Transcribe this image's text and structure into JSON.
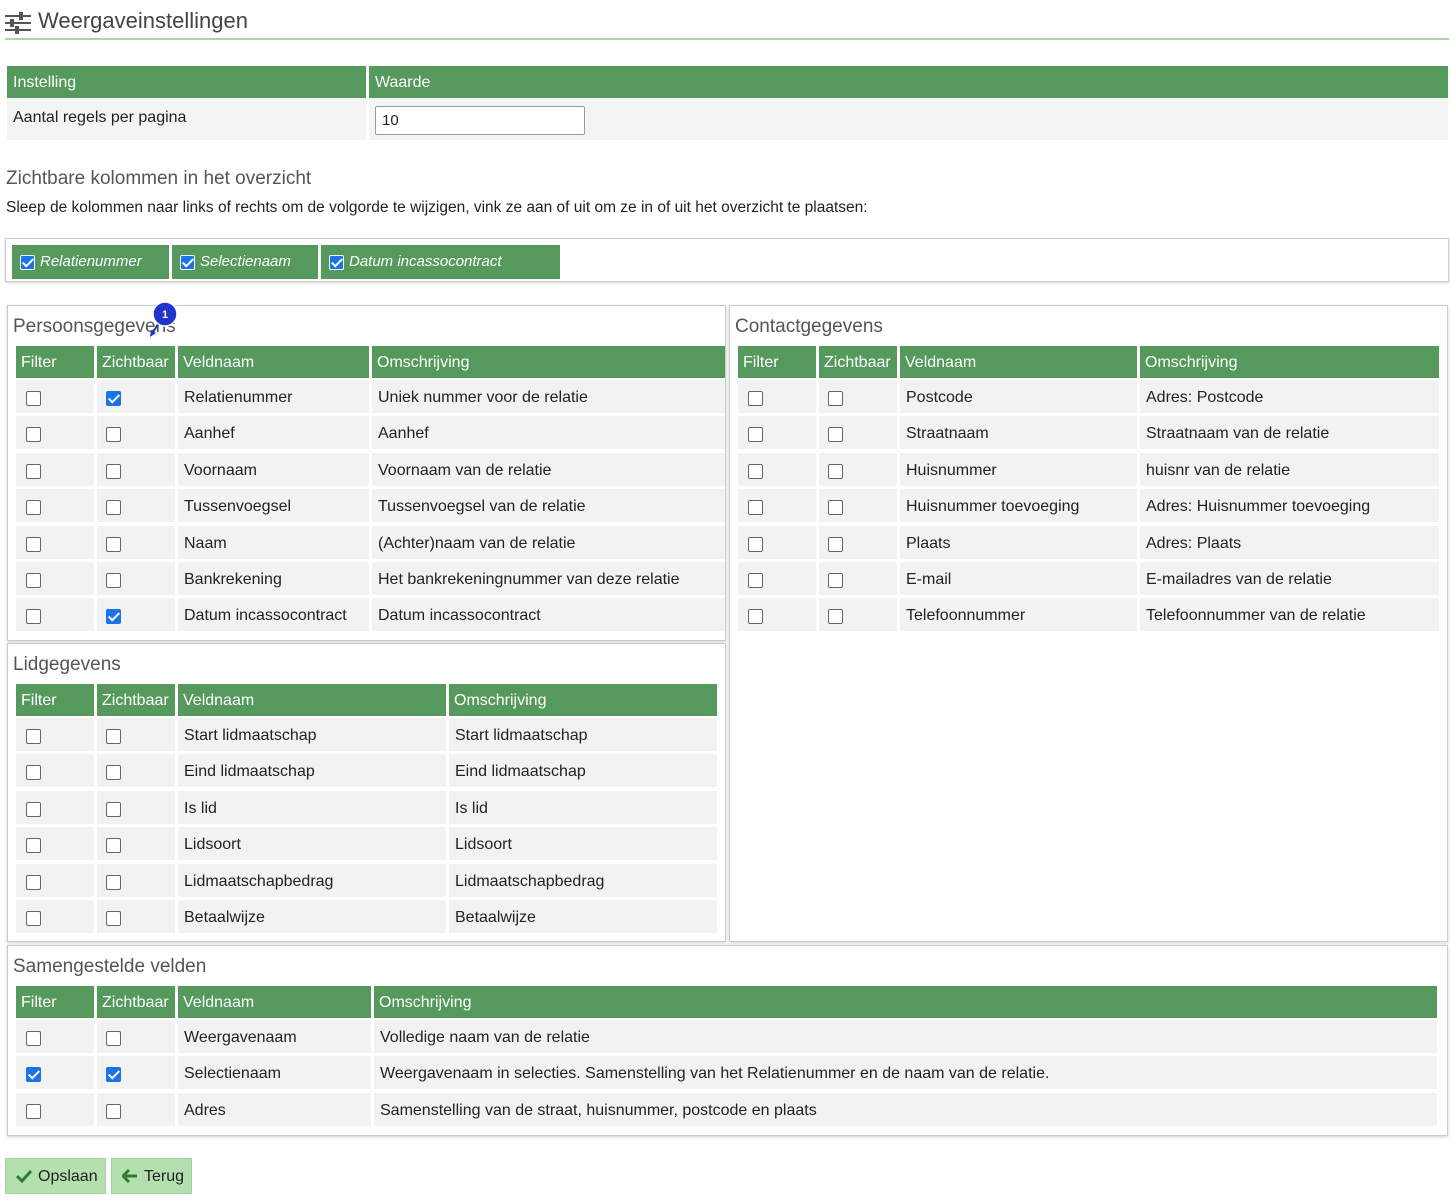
{
  "page": {
    "title": "Weergaveinstellingen"
  },
  "settings": {
    "col_setting": "Instelling",
    "col_value": "Waarde",
    "rows_label": "Aantal regels per pagina",
    "rows_value": "10"
  },
  "columns_section": {
    "title": "Zichtbare kolommen in het overzicht",
    "description": "Sleep de kolommen naar links of rechts om de volgorde te wijzigen, vink ze aan of uit om ze in of uit het overzicht te plaatsen:",
    "chips": [
      "Relatienummer",
      "Selectienaam",
      "Datum incassocontract"
    ]
  },
  "headers": {
    "filter": "Filter",
    "visible": "Zichtbaar",
    "field": "Veldnaam",
    "description": "Omschrijving"
  },
  "persoonsgegevens": {
    "title": "Persoonsgegevens",
    "rows": [
      {
        "filter": false,
        "visible": true,
        "field": "Relatienummer",
        "description": "Uniek nummer voor de relatie"
      },
      {
        "filter": false,
        "visible": false,
        "field": "Aanhef",
        "description": "Aanhef"
      },
      {
        "filter": false,
        "visible": false,
        "field": "Voornaam",
        "description": "Voornaam van de relatie"
      },
      {
        "filter": false,
        "visible": false,
        "field": "Tussenvoegsel",
        "description": "Tussenvoegsel van de relatie"
      },
      {
        "filter": false,
        "visible": false,
        "field": "Naam",
        "description": "(Achter)naam van de relatie"
      },
      {
        "filter": false,
        "visible": false,
        "field": "Bankrekening",
        "description": "Het bankrekeningnummer van deze relatie"
      },
      {
        "filter": false,
        "visible": true,
        "field": "Datum incassocontract",
        "description": "Datum incassocontract"
      }
    ]
  },
  "contactgegevens": {
    "title": "Contactgegevens",
    "rows": [
      {
        "filter": false,
        "visible": false,
        "field": "Postcode",
        "description": "Adres: Postcode"
      },
      {
        "filter": false,
        "visible": false,
        "field": "Straatnaam",
        "description": "Straatnaam van de relatie"
      },
      {
        "filter": false,
        "visible": false,
        "field": "Huisnummer",
        "description": "huisnr van de relatie"
      },
      {
        "filter": false,
        "visible": false,
        "field": "Huisnummer toevoeging",
        "description": "Adres: Huisnummer toevoeging"
      },
      {
        "filter": false,
        "visible": false,
        "field": "Plaats",
        "description": "Adres: Plaats"
      },
      {
        "filter": false,
        "visible": false,
        "field": "E-mail",
        "description": "E-mailadres van de relatie"
      },
      {
        "filter": false,
        "visible": false,
        "field": "Telefoonnummer",
        "description": "Telefoonnummer van de relatie"
      }
    ]
  },
  "lidgegevens": {
    "title": "Lidgegevens",
    "rows": [
      {
        "filter": false,
        "visible": false,
        "field": "Start lidmaatschap",
        "description": "Start lidmaatschap"
      },
      {
        "filter": false,
        "visible": false,
        "field": "Eind lidmaatschap",
        "description": "Eind lidmaatschap"
      },
      {
        "filter": false,
        "visible": false,
        "field": "Is lid",
        "description": "Is lid"
      },
      {
        "filter": false,
        "visible": false,
        "field": "Lidsoort",
        "description": "Lidsoort"
      },
      {
        "filter": false,
        "visible": false,
        "field": "Lidmaatschapbedrag",
        "description": "Lidmaatschapbedrag"
      },
      {
        "filter": false,
        "visible": false,
        "field": "Betaalwijze",
        "description": "Betaalwijze"
      }
    ]
  },
  "samengestelde": {
    "title": "Samengestelde velden",
    "rows": [
      {
        "filter": false,
        "visible": false,
        "field": "Weergavenaam",
        "description": "Volledige naam van de relatie"
      },
      {
        "filter": true,
        "visible": true,
        "field": "Selectienaam",
        "description": "Weergavenaam in selecties. Samenstelling van het Relatienummer en de naam van de relatie."
      },
      {
        "filter": false,
        "visible": false,
        "field": "Adres",
        "description": "Samenstelling van de straat, huisnummer, postcode en plaats"
      }
    ]
  },
  "buttons": {
    "save": "Opslaan",
    "back": "Terug"
  },
  "annotation": {
    "marker": "1"
  },
  "colors": {
    "header_green": "#559a5c",
    "button_green": "#b4e0b0",
    "check_blue": "#1a73e8"
  }
}
